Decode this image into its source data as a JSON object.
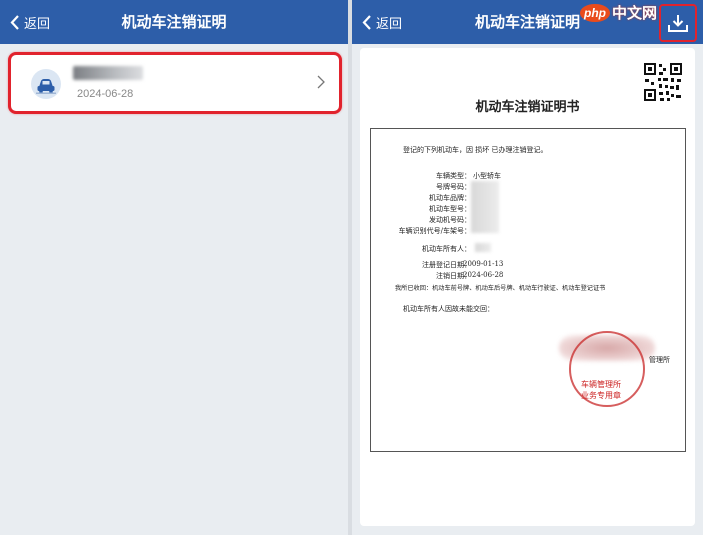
{
  "left": {
    "nav": {
      "back_label": "返回",
      "title": "机动车注销证明"
    },
    "card": {
      "date": "2024-06-28"
    }
  },
  "right": {
    "nav": {
      "back_label": "返回",
      "title": "机动车注销证明"
    },
    "watermark": {
      "php": "php",
      "cn": "中文网"
    },
    "certificate": {
      "title": "机动车注销证明书",
      "intro": "登记的下列机动车，因   损坏   已办理注销登记。",
      "fields": [
        {
          "label": "车辆类型：",
          "value": "小型轿车"
        },
        {
          "label": "号牌号码：",
          "value": ""
        },
        {
          "label": "机动车品牌：",
          "value": ""
        },
        {
          "label": "机动车型号：",
          "value": ""
        },
        {
          "label": "发动机号码：",
          "value": ""
        },
        {
          "label": "车辆识别代号/车架号：",
          "value": ""
        }
      ],
      "owner_label": "机动车所有人：",
      "reg_date_label": "注册登记日期：",
      "reg_date": "2009-01-13",
      "cancel_date_label": "注销日期：",
      "cancel_date": "2024-06-28",
      "recovered": "我所已收回：机动车前号牌、机动车后号牌、机动车行驶证、机动车登记证书",
      "owner_note": "机动车所有人因故未能交回：",
      "authority_suffix": "管理所",
      "seal_line1": "车辆管理所",
      "seal_line2": "业务专用章"
    }
  },
  "colors": {
    "nav_bg": "#2d5ea9",
    "highlight": "#e1232d"
  }
}
